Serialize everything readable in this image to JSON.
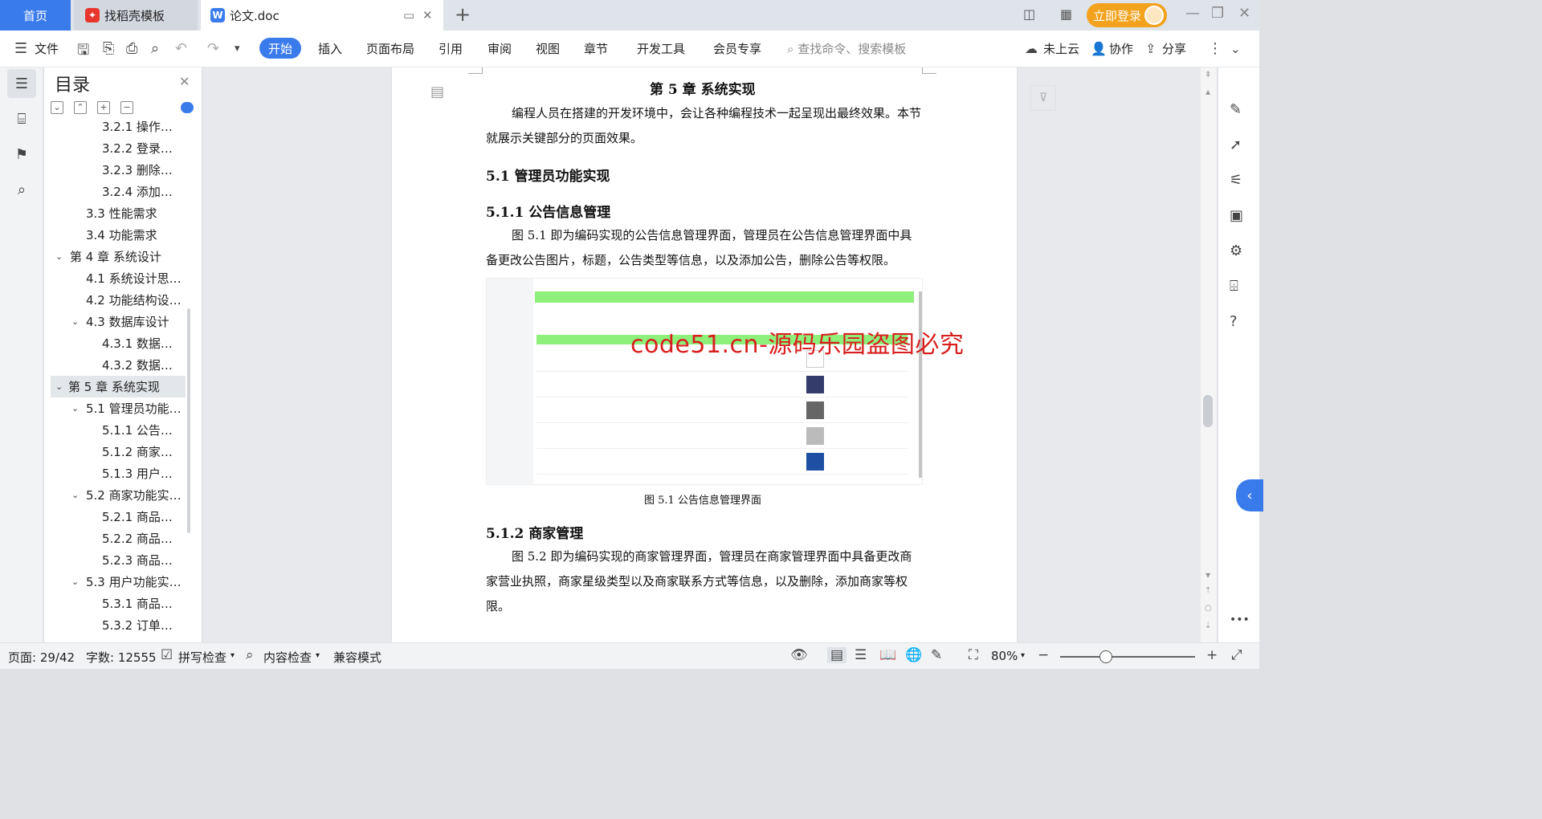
{
  "tabs": {
    "home": "首页",
    "template_tab": "找稻壳模板",
    "doc_tab": "论文.doc",
    "login": "立即登录"
  },
  "toolbar": {
    "file": "文件",
    "menus": [
      "开始",
      "插入",
      "页面布局",
      "引用",
      "审阅",
      "视图",
      "章节",
      "开发工具",
      "会员专享"
    ],
    "search_placeholder": "查找命令、搜索模板",
    "cloud": "未上云",
    "collab": "协作",
    "share": "分享"
  },
  "toc": {
    "title": "目录",
    "items": [
      {
        "label": "3.2.1 操作…",
        "level": 3
      },
      {
        "label": "3.2.2 登录…",
        "level": 3
      },
      {
        "label": "3.2.3 删除…",
        "level": 3
      },
      {
        "label": "3.2.4 添加…",
        "level": 3
      },
      {
        "label": "3.3 性能需求",
        "level": 2
      },
      {
        "label": "3.4 功能需求",
        "level": 2
      },
      {
        "label": "第 4 章 系统设计",
        "level": 1,
        "expanded": true
      },
      {
        "label": "4.1 系统设计思…",
        "level": 2
      },
      {
        "label": "4.2 功能结构设…",
        "level": 2
      },
      {
        "label": "4.3 数据库设计",
        "level": 2,
        "expanded": true
      },
      {
        "label": "4.3.1 数据…",
        "level": 3
      },
      {
        "label": "4.3.2 数据…",
        "level": 3
      },
      {
        "label": "第 5 章 系统实现",
        "level": 1,
        "expanded": true,
        "selected": true
      },
      {
        "label": "5.1 管理员功能…",
        "level": 2,
        "expanded": true
      },
      {
        "label": "5.1.1 公告…",
        "level": 3
      },
      {
        "label": "5.1.2 商家…",
        "level": 3
      },
      {
        "label": "5.1.3 用户…",
        "level": 3
      },
      {
        "label": "5.2 商家功能实…",
        "level": 2,
        "expanded": true
      },
      {
        "label": "5.2.1 商品…",
        "level": 3
      },
      {
        "label": "5.2.2 商品…",
        "level": 3
      },
      {
        "label": "5.2.3 商品…",
        "level": 3
      },
      {
        "label": "5.3 用户功能实…",
        "level": 2,
        "expanded": true
      },
      {
        "label": "5.3.1 商品…",
        "level": 3
      },
      {
        "label": "5.3.2 订单…",
        "level": 3
      }
    ]
  },
  "document": {
    "chapter_title": "第 5 章 系统实现",
    "intro": "编程人员在搭建的开发环境中，会让各种编程技术一起呈现出最终效果。本节就展示关键部分的页面效果。",
    "section_5_1": "5.1 管理员功能实现",
    "section_5_1_1": "5.1.1 公告信息管理",
    "para_5_1_1": "图 5.1 即为编码实现的公告信息管理界面，管理员在公告信息管理界面中具备更改公告图片，标题，公告类型等信息，以及添加公告，删除公告等权限。",
    "figure_caption": "图 5.1 公告信息管理界面",
    "section_5_1_2": "5.1.2 商家管理",
    "para_5_1_2": "图 5.2 即为编码实现的商家管理界面，管理员在商家管理界面中具备更改商家营业执照，商家星级类型以及商家联系方式等信息，以及删除，添加商家等权限。",
    "watermark": "code51.cn-源码乐园盗图必究"
  },
  "status": {
    "page": "页面: 29/42",
    "words": "字数: 12555",
    "spellcheck": "拼写检查",
    "content_check": "内容检查",
    "compat": "兼容模式",
    "zoom": "80%",
    "zoom_level": 0.34
  },
  "colors": {
    "accent": "#3a7bec",
    "login": "#f2a21c",
    "watermark": "#d81e1e"
  }
}
